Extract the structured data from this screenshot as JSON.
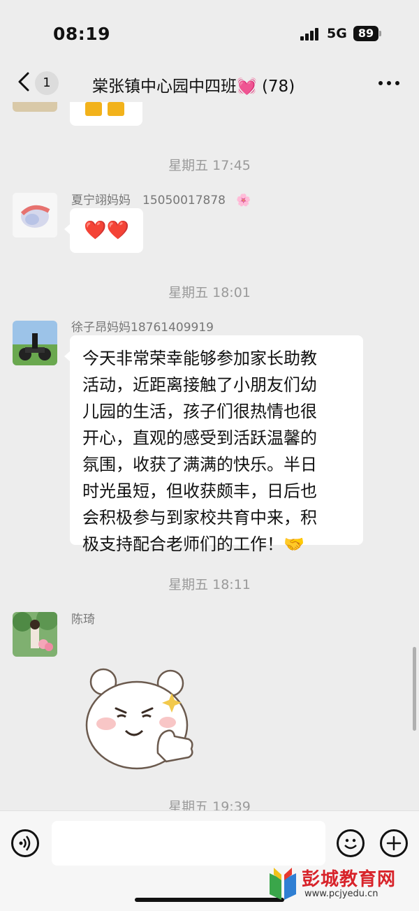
{
  "status_bar": {
    "time": "08:19",
    "network": "5G",
    "battery": "89"
  },
  "nav": {
    "unread_count": "1",
    "title": "棠张镇中心园中四班",
    "title_emoji": "💓",
    "member_count": "(78)"
  },
  "chat": {
    "timestamps": [
      "星期五 17:45",
      "星期五 18:01",
      "星期五 18:11",
      "星期五 19:39"
    ],
    "messages": [
      {
        "sender": "夏宁翊妈妈　15050017878",
        "sender_emoji": "🌸",
        "content": "❤️❤️"
      },
      {
        "sender": "徐子昂妈妈18761409919",
        "lines": [
          "今天非常荣幸能够参加家长助教",
          "活动，近距离接触了小朋友们幼",
          "儿园的生活，孩子们很热情也很",
          "开心，直观的感受到活跃温馨的",
          "氛围，收获了满满的快乐。半日",
          "时光虽短，但收获颇丰，日后也",
          "会积极参与到家校共育中来，积",
          "极支持配合老师们的工作！🤝"
        ]
      },
      {
        "sender": "陈琦",
        "sticker": "bear-thumbs-up-sticker"
      }
    ]
  },
  "input": {
    "placeholder": ""
  },
  "watermark": {
    "name": "彭城教育网",
    "url": "www.pcjyedu.cn"
  },
  "colors": {
    "background": "#ededed",
    "bubble": "#ffffff",
    "timestamp": "#9a9a9a"
  }
}
